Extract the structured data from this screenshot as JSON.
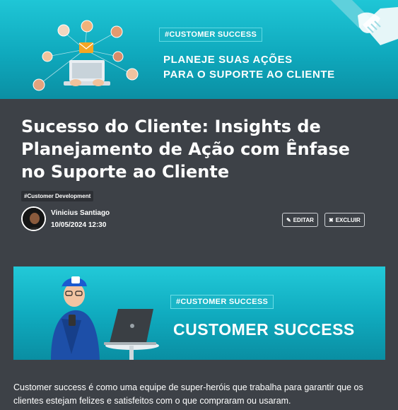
{
  "top_banner": {
    "tag": "#CUSTOMER SUCCESS",
    "line1": "PLANEJE SUAS AÇÕES",
    "line2": "PARA O SUPORTE AO CLIENTE"
  },
  "article": {
    "title": "Sucesso do Cliente: Insights de Planejamento de Ação com Ênfase no Suporte ao Cliente",
    "category": "#Customer Development",
    "author": "Vinicius Santiago",
    "date": "10/05/2024 12:30",
    "edit_label": "EDITAR",
    "delete_label": "EXCLUIR",
    "edit_icon": "pencil-icon",
    "delete_icon": "close-icon"
  },
  "banner2": {
    "tag": "#CUSTOMER SUCCESS",
    "headline": "CUSTOMER SUCCESS"
  },
  "body_text": "Customer success é como uma equipe de super-heróis que trabalha para garantir que os clientes estejam felizes e satisfeitos com o que compraram ou usaram.",
  "colors": {
    "page_bg": "#3d4147",
    "banner_teal": "#10acc0"
  }
}
